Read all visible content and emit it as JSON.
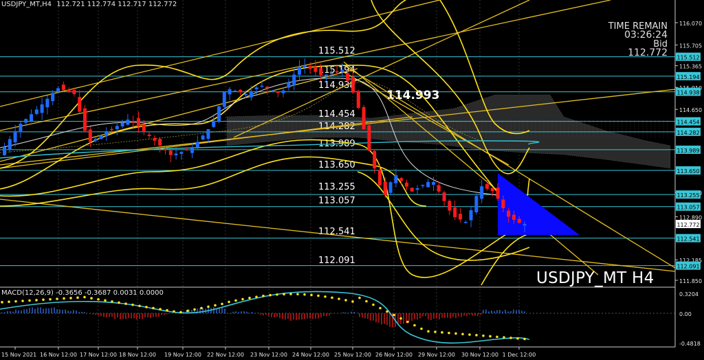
{
  "header": {
    "symbol_timeframe": "USDJPY_MT,H4",
    "ohlc": "112.721 112.774 112.717 112.772"
  },
  "timer": {
    "label": "TIME REMAIN",
    "value": "03:26:24",
    "bid_label": "Bid",
    "bid_value": "112.772"
  },
  "watermark": "USDJPY_MT H4",
  "levels": [
    {
      "label": "115.512",
      "price": 115.512
    },
    {
      "label": "115.194",
      "price": 115.194
    },
    {
      "label": "114.938",
      "price": 114.938
    },
    {
      "label": "114.454",
      "price": 114.454
    },
    {
      "label": "114.282",
      "price": 114.282
    },
    {
      "label": "113.989",
      "price": 113.989
    },
    {
      "label": "113.650",
      "price": 113.65
    },
    {
      "label": "113.255",
      "price": 113.255
    },
    {
      "label": "113.057",
      "price": 113.057
    },
    {
      "label": "112.541",
      "price": 112.541
    },
    {
      "label": "112.091",
      "price": 112.091
    }
  ],
  "level_texts": [
    "115.512",
    "115.194",
    "114.938",
    "114.454",
    "114.282",
    "113.989",
    "113.650",
    "113.255",
    "113.057",
    "112.541",
    "112.091"
  ],
  "annotation": "114.993",
  "price_axis_ticks": [
    "116.070",
    "115.705",
    "115.365",
    "115.010",
    "114.650",
    "113.290",
    "112.890",
    "112.185",
    "111.850"
  ],
  "current_price": "112.772",
  "time_axis": [
    "15 Nov 2021",
    "16 Nov 12:00",
    "17 Nov 12:00",
    "18 Nov 12:00",
    "19 Nov 12:00",
    "22 Nov 12:00",
    "23 Nov 12:00",
    "24 Nov 12:00",
    "25 Nov 12:00",
    "26 Nov 12:00",
    "29 Nov 12:00",
    "30 Nov 12:00",
    "1 Dec 12:00"
  ],
  "macd": {
    "label": "MACD(12,26,9) -0.3656 -0.3687 0.0031 0.0000",
    "axis": [
      "0.3204",
      "0.00",
      "-0.4818"
    ]
  },
  "colors": {
    "up": "#1e6bff",
    "down": "#ff1a1a",
    "bands": "#ffe21a",
    "level_line": "#39c7d8",
    "triangle": "#0a0aff"
  },
  "chart_data": {
    "type": "candlestick",
    "title": "USDJPY_MT,H4",
    "ylim": [
      111.8,
      116.35
    ],
    "x": [
      "15 Nov 2021",
      "16 Nov 12:00",
      "17 Nov 12:00",
      "18 Nov 12:00",
      "19 Nov 12:00",
      "22 Nov 12:00",
      "23 Nov 12:00",
      "24 Nov 12:00",
      "25 Nov 12:00",
      "26 Nov 12:00",
      "29 Nov 12:00",
      "30 Nov 12:00",
      "1 Dec 12:00"
    ],
    "close": [
      113.8,
      114.6,
      114.2,
      114.3,
      113.8,
      114.8,
      115.1,
      115.3,
      114.7,
      113.1,
      113.4,
      113.5,
      112.77
    ]
  }
}
